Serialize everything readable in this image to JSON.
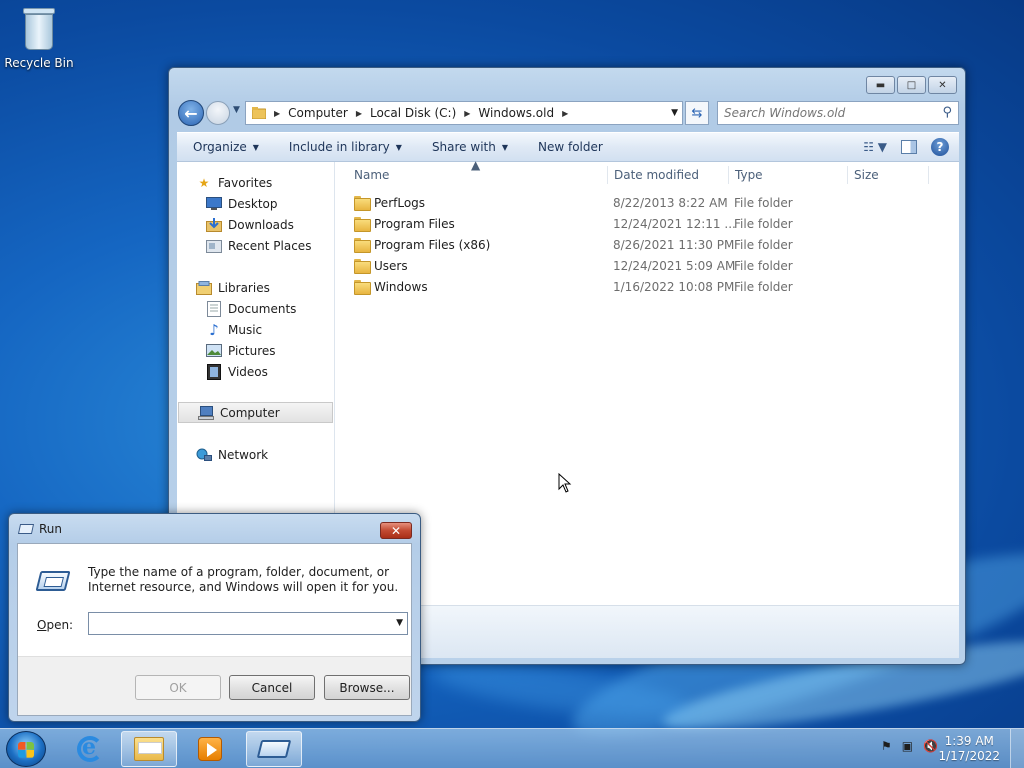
{
  "desktop": {
    "icons": [
      {
        "label": "Recycle Bin"
      }
    ]
  },
  "explorer": {
    "nav": {
      "breadcrumb": [
        "Computer",
        "Local Disk (C:)",
        "Windows.old"
      ]
    },
    "search": {
      "placeholder": "Search Windows.old"
    },
    "toolbar": {
      "organize": "Organize",
      "include_in_library": "Include in library",
      "share_with": "Share with",
      "new_folder": "New folder"
    },
    "sidebar": {
      "favorites": "Favorites",
      "favorites_items": [
        "Desktop",
        "Downloads",
        "Recent Places"
      ],
      "libraries": "Libraries",
      "libraries_items": [
        "Documents",
        "Music",
        "Pictures",
        "Videos"
      ],
      "computer": "Computer",
      "network": "Network"
    },
    "columns": {
      "name": "Name",
      "date_modified": "Date modified",
      "type": "Type",
      "size": "Size"
    },
    "files": [
      {
        "name": "PerfLogs",
        "date": "8/22/2013 8:22 AM",
        "type": "File folder"
      },
      {
        "name": "Program Files",
        "date": "12/24/2021 12:11 ...",
        "type": "File folder"
      },
      {
        "name": "Program Files (x86)",
        "date": "8/26/2021 11:30 PM",
        "type": "File folder"
      },
      {
        "name": "Users",
        "date": "12/24/2021 5:09 AM",
        "type": "File folder"
      },
      {
        "name": "Windows",
        "date": "1/16/2022 10:08 PM",
        "type": "File folder"
      }
    ]
  },
  "run_dialog": {
    "title": "Run",
    "description": "Type the name of a program, folder, document, or Internet resource, and Windows will open it for you.",
    "open_label_prefix": "",
    "open_label_underlined": "O",
    "open_label_rest": "pen:",
    "open_value": "",
    "buttons": {
      "ok": "OK",
      "cancel": "Cancel",
      "browse": "Browse..."
    }
  },
  "taskbar": {
    "clock_time": "1:39 AM",
    "clock_date": "1/17/2022"
  },
  "icons": {
    "recycle_bin": "recycle-bin-icon",
    "back": "back-arrow-icon",
    "forward": "forward-arrow-icon",
    "refresh": "refresh-icon",
    "search": "search-icon",
    "help": "help-icon",
    "folder": "folder-icon"
  }
}
